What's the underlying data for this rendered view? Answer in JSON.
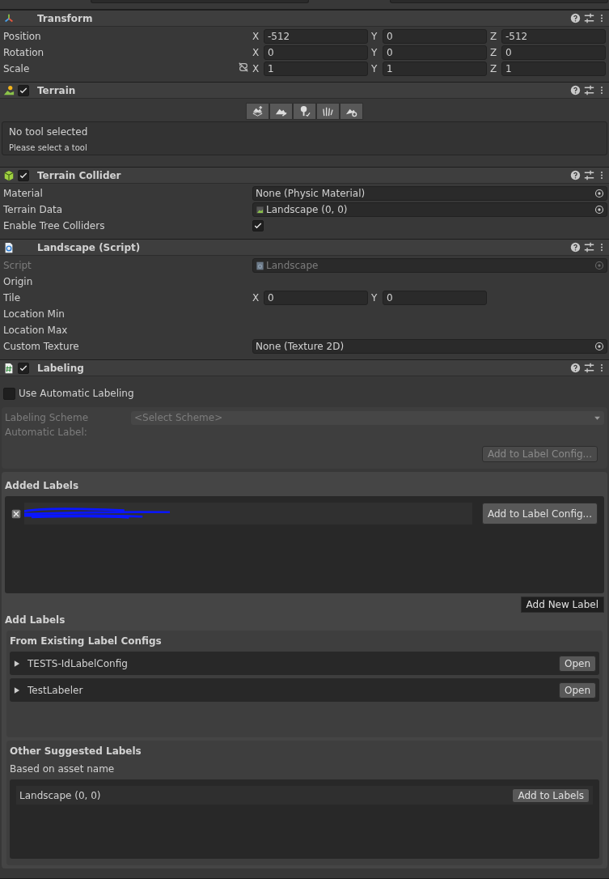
{
  "components": [
    {
      "title": "Transform",
      "rows": [
        {
          "kind": "vector",
          "label": "Position",
          "fields": [
            {
              "axis": "X",
              "value": "-512"
            },
            {
              "axis": "Y",
              "value": "0"
            },
            {
              "axis": "Z",
              "value": "-512"
            }
          ]
        },
        {
          "kind": "vector",
          "label": "Rotation",
          "fields": [
            {
              "axis": "X",
              "value": "0"
            },
            {
              "axis": "Y",
              "value": "0"
            },
            {
              "axis": "Z",
              "value": "0"
            }
          ]
        },
        {
          "kind": "vector",
          "label": "Scale",
          "lock_icon": true,
          "fields": [
            {
              "axis": "X",
              "value": "1"
            },
            {
              "axis": "Y",
              "value": "1"
            },
            {
              "axis": "Z",
              "value": "1"
            }
          ]
        }
      ]
    },
    {
      "title": "Terrain",
      "enabled": true,
      "tools": [
        {
          "selected": false
        },
        {
          "selected": false
        },
        {
          "selected": false
        },
        {
          "selected": false
        },
        {
          "selected": false
        }
      ],
      "help": {
        "title": "No tool selected",
        "text": "Please select a tool"
      }
    },
    {
      "title": "Terrain Collider",
      "enabled": true,
      "rows": [
        {
          "kind": "object",
          "label": "Material",
          "value": "None (Physic Material)"
        },
        {
          "kind": "terrain-asset",
          "label": "Terrain Data",
          "value": "Landscape (0, 0)"
        },
        {
          "kind": "checkbox",
          "label": "Enable Tree Colliders",
          "checked": true
        }
      ]
    },
    {
      "title": "Landscape (Script)",
      "rows": [
        {
          "kind": "script-asset",
          "label": "Script",
          "value": "Landscape",
          "disabled": true
        },
        {
          "kind": "empty",
          "label": "Origin"
        },
        {
          "kind": "vector",
          "label": "Tile",
          "fields": [
            {
              "axis": "X",
              "value": "0"
            },
            {
              "axis": "Y",
              "value": "0"
            }
          ]
        },
        {
          "kind": "empty",
          "label": "Location Min"
        },
        {
          "kind": "empty",
          "label": "Location Max"
        },
        {
          "kind": "object",
          "label": "Custom Texture",
          "value": "None (Texture 2D)"
        }
      ]
    },
    {
      "title": "Labeling",
      "enabled": true,
      "labeling": {
        "use_automatic": {
          "label": "Use Automatic Labeling",
          "checked": false
        },
        "scheme": {
          "label": "Labeling Scheme",
          "value": "<Select Scheme>",
          "auto_label": "Automatic Label:",
          "button": "Add to Label Config...",
          "disabled": true
        },
        "added_labels": {
          "title": "Added Labels",
          "items": [
            {
              "button": "Add to Label Config..."
            }
          ],
          "add_button": "Add New Label"
        },
        "add_labels": {
          "title": "Add Labels",
          "existing": {
            "title": "From Existing Label Configs",
            "items": [
              {
                "name": "TESTS-IdLabelConfig",
                "expanded": false,
                "button": "Open"
              },
              {
                "name": "TestLabeler",
                "expanded": false,
                "button": "Open"
              }
            ]
          },
          "suggested": {
            "title": "Other Suggested Labels",
            "subtitle": "Based on asset name",
            "items": [
              {
                "name": "Landscape (0, 0)",
                "button": "Add to Labels"
              }
            ]
          }
        }
      }
    }
  ]
}
